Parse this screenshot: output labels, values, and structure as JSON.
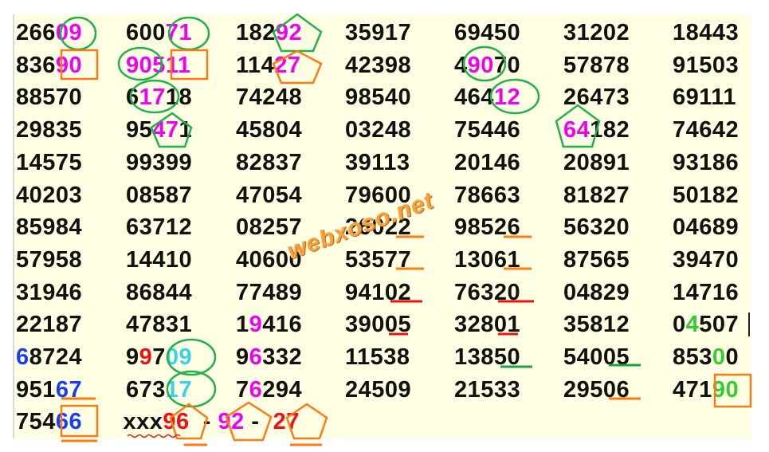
{
  "rows": [
    [
      [
        {
          "t": "266"
        },
        {
          "t": "09",
          "c": "#f000f0"
        }
      ],
      [
        {
          "t": "600"
        },
        {
          "t": "71",
          "c": "#f000f0"
        }
      ],
      [
        {
          "t": "182"
        },
        {
          "t": "92",
          "c": "#f000f0"
        }
      ],
      [
        {
          "t": "35917"
        }
      ],
      [
        {
          "t": "69450"
        }
      ],
      [
        {
          "t": "31202"
        }
      ],
      [
        {
          "t": "18443"
        }
      ]
    ],
    [
      [
        {
          "t": "836"
        },
        {
          "t": "90",
          "c": "#f000f0"
        }
      ],
      [
        {
          "t": "905",
          "c": "#f000f0"
        },
        {
          "t": "11",
          "c": "#f000f0"
        }
      ],
      [
        {
          "t": "114"
        },
        {
          "t": "27",
          "c": "#f000f0"
        }
      ],
      [
        {
          "t": "42398"
        }
      ],
      [
        {
          "t": "4"
        },
        {
          "t": "90",
          "c": "#f000f0"
        },
        {
          "t": "70"
        }
      ],
      [
        {
          "t": "57878"
        }
      ],
      [
        {
          "t": "91503"
        }
      ]
    ],
    [
      [
        {
          "t": "88570"
        }
      ],
      [
        {
          "t": "6"
        },
        {
          "t": "17",
          "c": "#f000f0"
        },
        {
          "t": "18"
        }
      ],
      [
        {
          "t": "74248"
        }
      ],
      [
        {
          "t": "98540"
        }
      ],
      [
        {
          "t": "464"
        },
        {
          "t": "12",
          "c": "#f000f0"
        }
      ],
      [
        {
          "t": "26473"
        }
      ],
      [
        {
          "t": "69111"
        }
      ]
    ],
    [
      [
        {
          "t": "29835"
        }
      ],
      [
        {
          "t": "95"
        },
        {
          "t": "47",
          "c": "#f000f0"
        },
        {
          "t": "1"
        }
      ],
      [
        {
          "t": "45804"
        }
      ],
      [
        {
          "t": "03248"
        }
      ],
      [
        {
          "t": "75446"
        }
      ],
      [
        {
          "t": "64",
          "c": "#f000f0"
        },
        {
          "t": "182"
        }
      ],
      [
        {
          "t": "74642"
        }
      ]
    ],
    [
      [
        {
          "t": "14575"
        }
      ],
      [
        {
          "t": "99399"
        }
      ],
      [
        {
          "t": "82837"
        }
      ],
      [
        {
          "t": "39113"
        }
      ],
      [
        {
          "t": "20146"
        }
      ],
      [
        {
          "t": "20891"
        }
      ],
      [
        {
          "t": "93186"
        }
      ]
    ],
    [
      [
        {
          "t": "40203"
        }
      ],
      [
        {
          "t": "08587"
        }
      ],
      [
        {
          "t": "47054"
        }
      ],
      [
        {
          "t": "79600"
        }
      ],
      [
        {
          "t": "78663"
        }
      ],
      [
        {
          "t": "81827"
        }
      ],
      [
        {
          "t": "50182"
        }
      ]
    ],
    [
      [
        {
          "t": "85984"
        }
      ],
      [
        {
          "t": "63712"
        }
      ],
      [
        {
          "t": "08257"
        }
      ],
      [
        {
          "t": "26022"
        }
      ],
      [
        {
          "t": "98526"
        }
      ],
      [
        {
          "t": "56320"
        }
      ],
      [
        {
          "t": "04689"
        }
      ]
    ],
    [
      [
        {
          "t": "57958"
        }
      ],
      [
        {
          "t": "14410"
        }
      ],
      [
        {
          "t": "40600"
        }
      ],
      [
        {
          "t": "53577"
        }
      ],
      [
        {
          "t": "13061"
        }
      ],
      [
        {
          "t": "87565"
        }
      ],
      [
        {
          "t": "39470"
        }
      ]
    ],
    [
      [
        {
          "t": "31946"
        }
      ],
      [
        {
          "t": "86844"
        }
      ],
      [
        {
          "t": "77489"
        }
      ],
      [
        {
          "t": "94102"
        }
      ],
      [
        {
          "t": "76320"
        }
      ],
      [
        {
          "t": "04829"
        }
      ],
      [
        {
          "t": "14716"
        }
      ]
    ],
    [
      [
        {
          "t": "22187"
        }
      ],
      [
        {
          "t": "47831"
        }
      ],
      [
        {
          "t": "1"
        },
        {
          "t": "9",
          "c": "#f000f0"
        },
        {
          "t": "416"
        }
      ],
      [
        {
          "t": "39005"
        }
      ],
      [
        {
          "t": "32801"
        }
      ],
      [
        {
          "t": "35812"
        }
      ],
      [
        {
          "t": "0"
        },
        {
          "t": "4",
          "c": "#33cc33"
        },
        {
          "t": "507"
        }
      ]
    ],
    [
      [
        {
          "t": "6",
          "c": "#1a3cff"
        },
        {
          "t": "8724"
        }
      ],
      [
        {
          "t": "9"
        },
        {
          "t": "9",
          "c": "#ee1111"
        },
        {
          "t": "7"
        },
        {
          "t": "09",
          "c": "#39d0ea"
        }
      ],
      [
        {
          "t": "9"
        },
        {
          "t": "6",
          "c": "#f000f0"
        },
        {
          "t": "332"
        }
      ],
      [
        {
          "t": "11538"
        }
      ],
      [
        {
          "t": "13850"
        }
      ],
      [
        {
          "t": "54005"
        }
      ],
      [
        {
          "t": "853"
        },
        {
          "t": "0",
          "c": "#33cc33"
        },
        {
          "t": "0"
        }
      ]
    ],
    [
      [
        {
          "t": "951"
        },
        {
          "t": "67",
          "c": "#1a3cff"
        }
      ],
      [
        {
          "t": "673"
        },
        {
          "t": "17",
          "c": "#39d0ea"
        }
      ],
      [
        {
          "t": "7"
        },
        {
          "t": "6",
          "c": "#f000f0"
        },
        {
          "t": "294"
        }
      ],
      [
        {
          "t": "24509"
        }
      ],
      [
        {
          "t": "21533"
        }
      ],
      [
        {
          "t": "29506"
        }
      ],
      [
        {
          "t": "471"
        },
        {
          "t": "90",
          "c": "#33cc33"
        }
      ]
    ]
  ],
  "last_row": [
    {
      "t": "754"
    },
    {
      "t": "66",
      "c": "#1a3cff"
    },
    {
      "t": "      "
    },
    {
      "t": "xxx"
    },
    {
      "t": "96",
      "c": "#ee1111"
    },
    {
      "t": "  - "
    },
    {
      "t": "92",
      "c": "#f000f0"
    },
    {
      "t": " -  "
    },
    {
      "t": "27",
      "c": "#ee1111"
    }
  ],
  "watermark": "webxoso.net",
  "colors": {
    "circle": "#22b04a",
    "pentagon_orange": "#ff7a10",
    "underline_orange": "#ff7a10",
    "underline_red": "#ee1111",
    "underline_green": "#22a040",
    "board": "#ffffe4"
  }
}
